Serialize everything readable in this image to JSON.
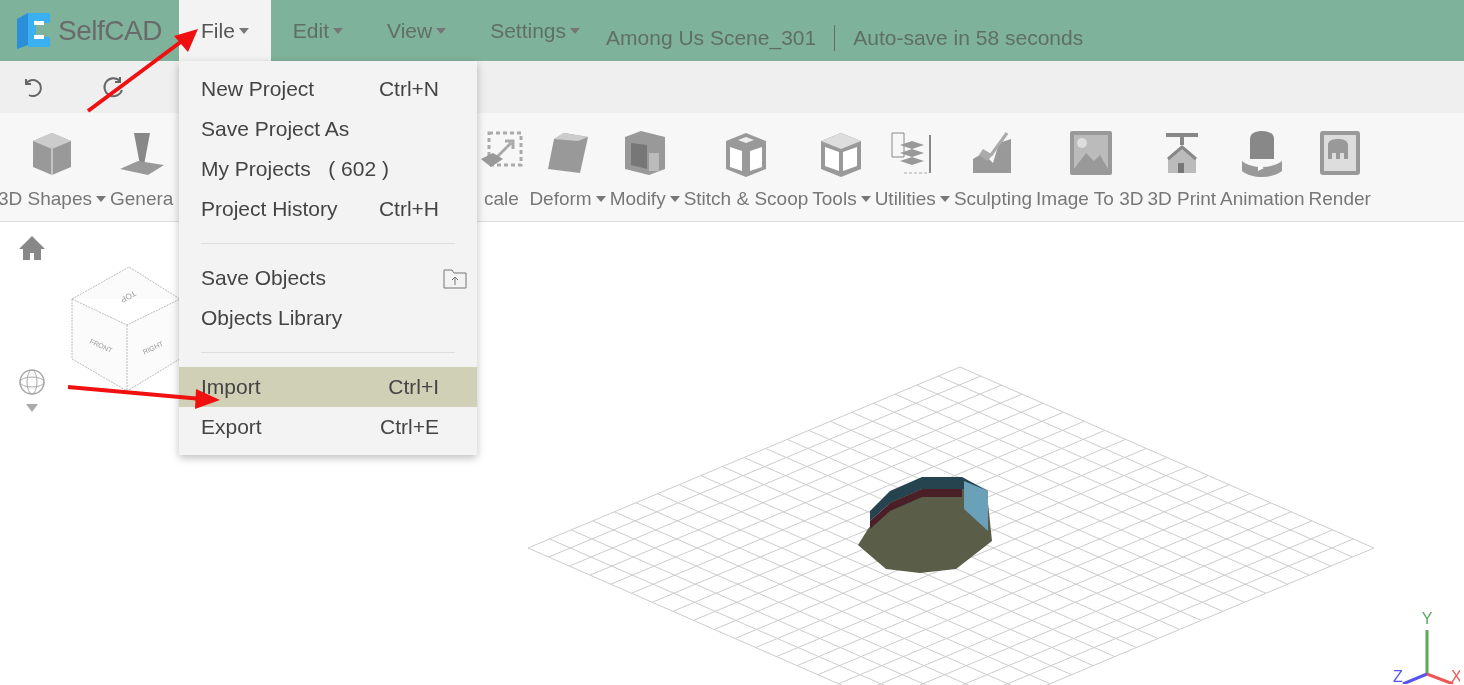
{
  "app": {
    "logo_text": "SelfCAD"
  },
  "menu_bar": [
    {
      "label": "File",
      "selected": true
    },
    {
      "label": "Edit",
      "selected": false
    },
    {
      "label": "View",
      "selected": false
    },
    {
      "label": "Settings",
      "selected": false
    }
  ],
  "project_title": "Among Us Scene_301",
  "autosave": "Auto-save in 58 seconds",
  "toolbar": [
    {
      "label": "3D Shapes",
      "dropdown": true
    },
    {
      "label": "Genera",
      "dropdown": false
    },
    {
      "label": "cale",
      "dropdown": false
    },
    {
      "label": "Deform",
      "dropdown": true
    },
    {
      "label": "Modify",
      "dropdown": true
    },
    {
      "label": "Stitch & Scoop",
      "dropdown": false
    },
    {
      "label": "Tools",
      "dropdown": true
    },
    {
      "label": "Utilities",
      "dropdown": true
    },
    {
      "label": "Sculpting",
      "dropdown": false
    },
    {
      "label": "Image To 3D",
      "dropdown": false
    },
    {
      "label": "3D Print",
      "dropdown": false
    },
    {
      "label": "Animation",
      "dropdown": false
    },
    {
      "label": "Render",
      "dropdown": false
    }
  ],
  "file_menu": [
    {
      "kind": "item",
      "label": "New Project",
      "shortcut": "Ctrl+N",
      "selected": false
    },
    {
      "kind": "item",
      "label": "Save Project As",
      "selected": false
    },
    {
      "kind": "item",
      "label": "My Projects",
      "count": "( 602 )",
      "selected": false
    },
    {
      "kind": "item",
      "label": "Project History",
      "shortcut": "Ctrl+H",
      "selected": false
    },
    {
      "kind": "separator"
    },
    {
      "kind": "item",
      "label": "Save Objects",
      "selected": false
    },
    {
      "kind": "item",
      "label": "Objects Library",
      "selected": false
    },
    {
      "kind": "separator"
    },
    {
      "kind": "item",
      "label": "Import",
      "shortcut": "Ctrl+I",
      "selected": true
    },
    {
      "kind": "item",
      "label": "Export",
      "shortcut": "Ctrl+E",
      "selected": false
    }
  ],
  "view_cube": {
    "top": "TOP",
    "front": "FRONT",
    "right": "RIGHT"
  },
  "axes": {
    "y": "Y",
    "z": "Z",
    "x": "X"
  }
}
